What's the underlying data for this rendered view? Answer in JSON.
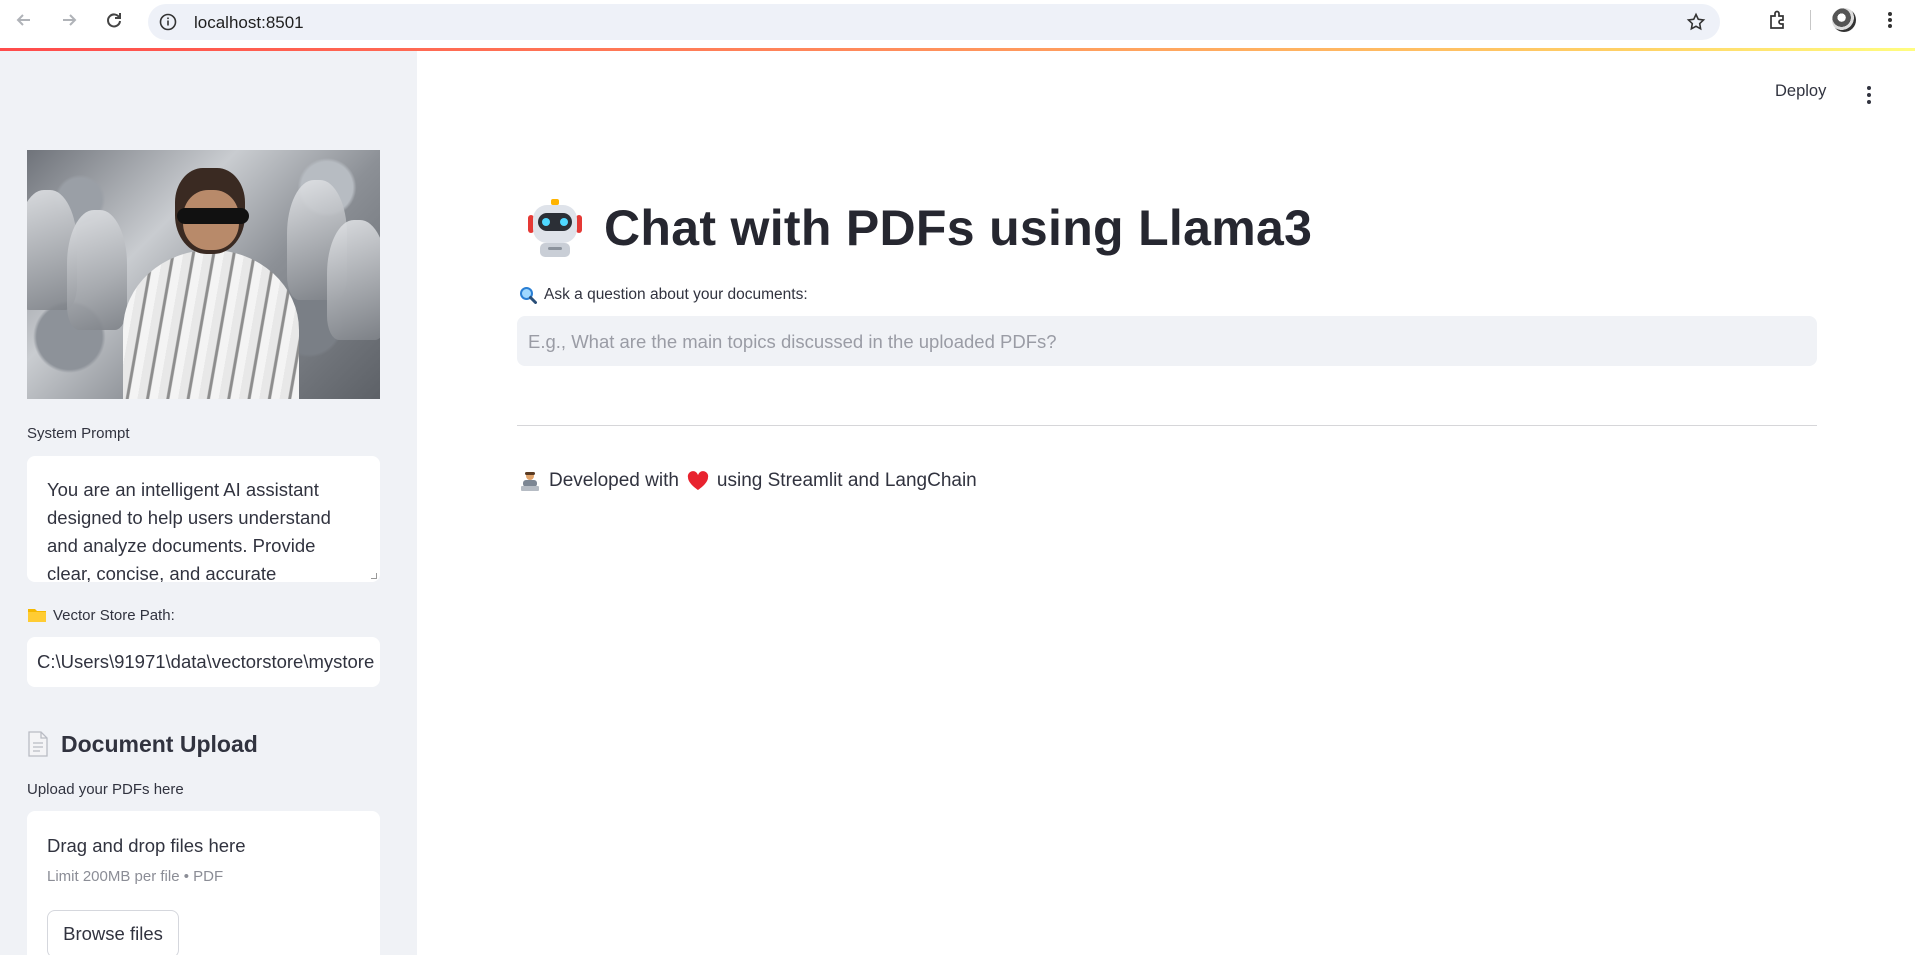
{
  "browser": {
    "url": "localhost:8501"
  },
  "sidebar": {
    "image_alt": "Rajinikanth in silver robot costume",
    "system_prompt_label": "System Prompt",
    "system_prompt_value": "You are an intelligent AI assistant designed to help users understand and analyze documents. Provide clear, concise, and accurate",
    "vector_store_label": "Vector Store Path:",
    "vector_store_icon": "folder-icon",
    "vector_store_value": "C:\\Users\\91971\\data\\vectorstore\\mystore",
    "upload_heading": "Document Upload",
    "upload_heading_icon": "page-icon",
    "upload_label": "Upload your PDFs here",
    "dropzone_title": "Drag and drop files here",
    "dropzone_limit": "Limit 200MB per file • PDF",
    "browse_label": "Browse files"
  },
  "header": {
    "deploy_label": "Deploy"
  },
  "main": {
    "title": "Chat with PDFs using Llama3",
    "title_icon": "robot-icon",
    "ask_label": "Ask a question about your documents:",
    "ask_icon": "magnifier-icon",
    "ask_placeholder": "E.g., What are the main topics discussed in the uploaded PDFs?",
    "footer_prefix": "Developed with",
    "footer_suffix": "using Streamlit and LangChain",
    "footer_icons": [
      "technologist-icon",
      "heart-icon"
    ]
  },
  "colors": {
    "sidebar_bg": "#f0f2f6",
    "accent": "#ff4b4b",
    "text": "#31333f"
  }
}
